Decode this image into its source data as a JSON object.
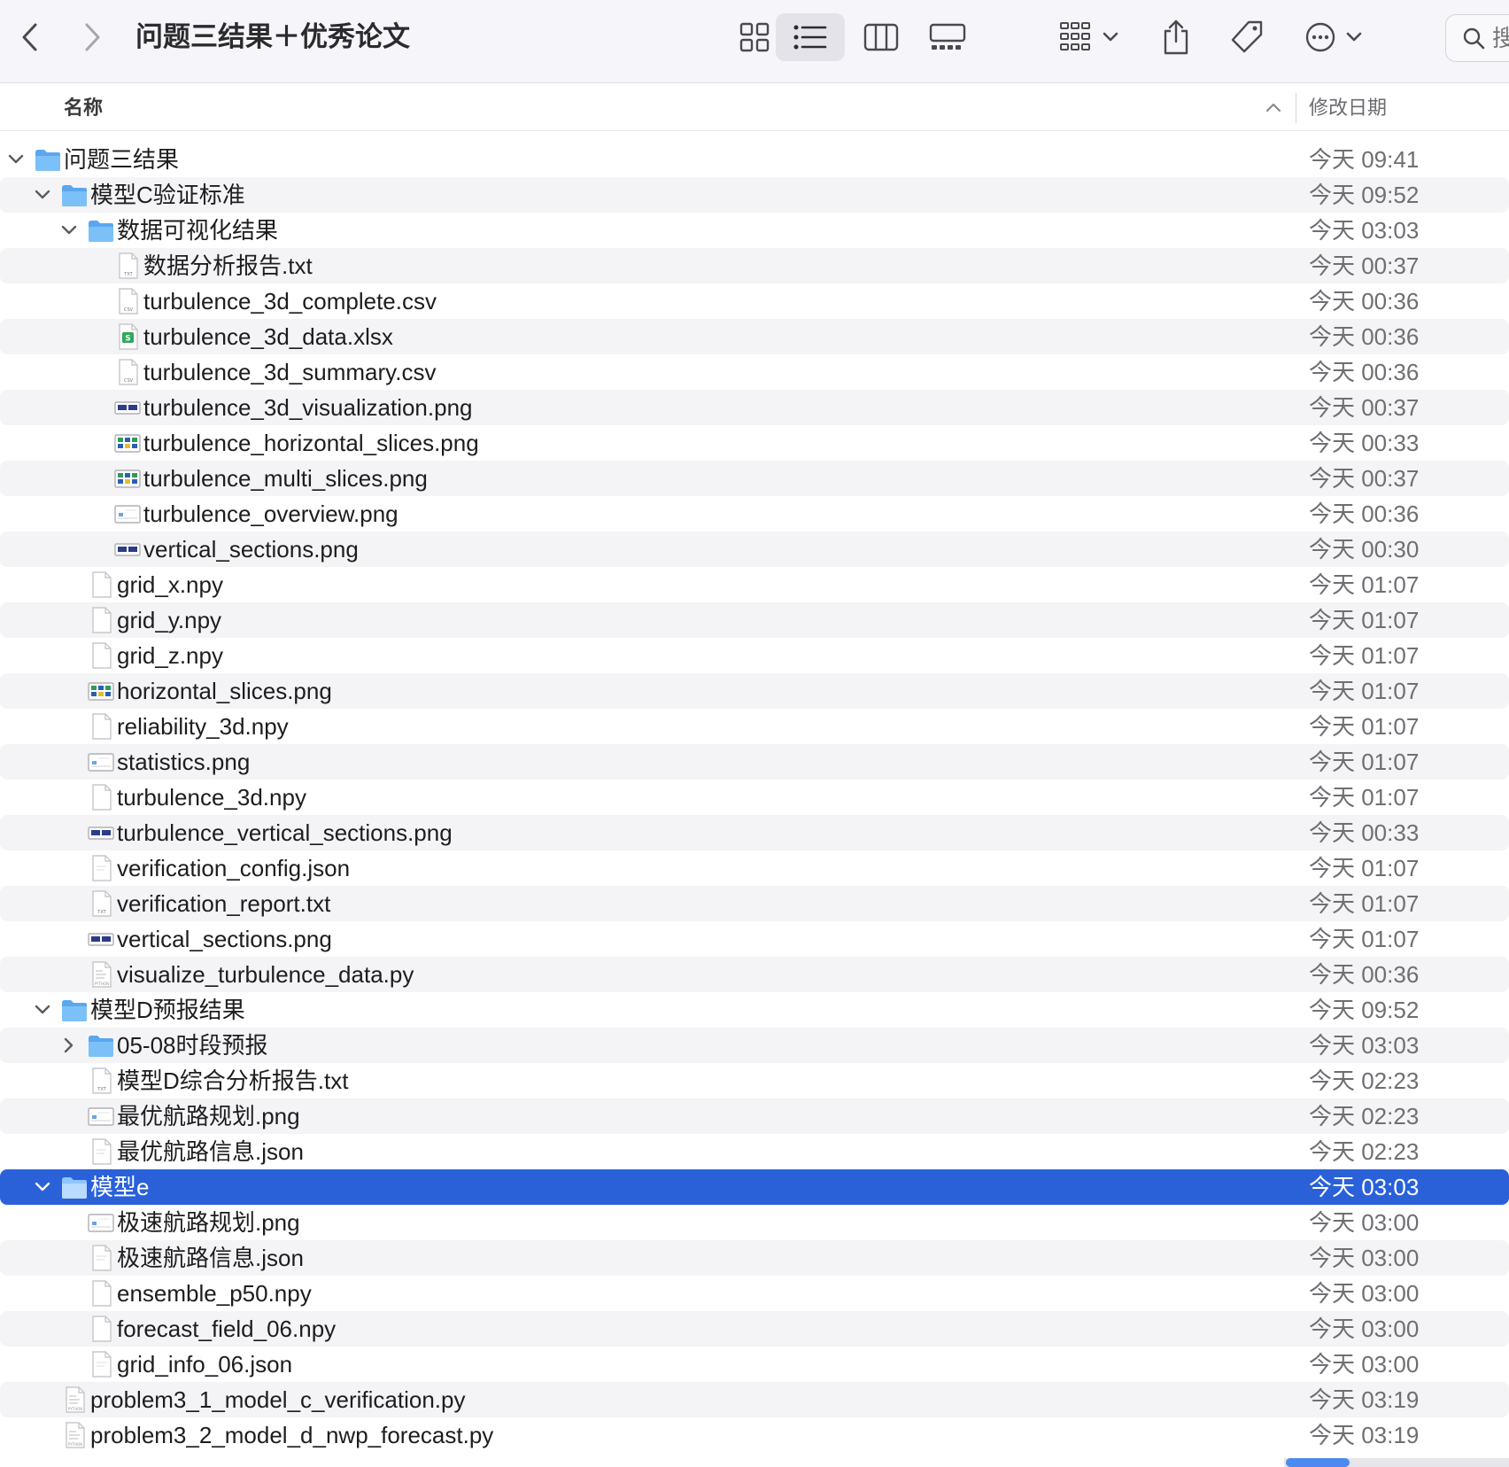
{
  "window": {
    "title": "问题三结果＋优秀论文"
  },
  "toolbar": {
    "back": "chevron-left-icon",
    "forward": "chevron-right-icon",
    "views": [
      "icon-view-icon",
      "list-view-icon",
      "column-view-icon",
      "gallery-view-icon"
    ],
    "active_view": "list",
    "group": "group-by-icon",
    "share": "share-icon",
    "tag": "tag-icon",
    "more": "more-icon",
    "search_placeholder": "搜索"
  },
  "columns": {
    "name": "名称",
    "date": "修改日期",
    "sort": "ascending"
  },
  "colors": {
    "selection": "#2a61d9",
    "folder": "#5aa7ee",
    "stripe": "#f4f4f6"
  },
  "rows": [
    {
      "name": "问题三结果",
      "date": "今天 09:41",
      "type": "folder",
      "depth": 0,
      "expanded": true
    },
    {
      "name": "模型C验证标准",
      "date": "今天 09:52",
      "type": "folder",
      "depth": 1,
      "expanded": true
    },
    {
      "name": "数据可视化结果",
      "date": "今天 03:03",
      "type": "folder",
      "depth": 2,
      "expanded": true
    },
    {
      "name": "数据分析报告.txt",
      "date": "今天 00:37",
      "type": "txt",
      "depth": 3
    },
    {
      "name": "turbulence_3d_complete.csv",
      "date": "今天 00:36",
      "type": "csv",
      "depth": 3
    },
    {
      "name": "turbulence_3d_data.xlsx",
      "date": "今天 00:36",
      "type": "xlsx",
      "depth": 3
    },
    {
      "name": "turbulence_3d_summary.csv",
      "date": "今天 00:36",
      "type": "csv",
      "depth": 3
    },
    {
      "name": "turbulence_3d_visualization.png",
      "date": "今天 00:37",
      "type": "png-wide",
      "depth": 3
    },
    {
      "name": "turbulence_horizontal_slices.png",
      "date": "今天 00:33",
      "type": "png-grid",
      "depth": 3
    },
    {
      "name": "turbulence_multi_slices.png",
      "date": "今天 00:37",
      "type": "png-grid",
      "depth": 3
    },
    {
      "name": "turbulence_overview.png",
      "date": "今天 00:36",
      "type": "png-light",
      "depth": 3
    },
    {
      "name": "vertical_sections.png",
      "date": "今天 00:30",
      "type": "png-wide",
      "depth": 3
    },
    {
      "name": "grid_x.npy",
      "date": "今天 01:07",
      "type": "blank",
      "depth": 2
    },
    {
      "name": "grid_y.npy",
      "date": "今天 01:07",
      "type": "blank",
      "depth": 2
    },
    {
      "name": "grid_z.npy",
      "date": "今天 01:07",
      "type": "blank",
      "depth": 2
    },
    {
      "name": "horizontal_slices.png",
      "date": "今天 01:07",
      "type": "png-grid",
      "depth": 2
    },
    {
      "name": "reliability_3d.npy",
      "date": "今天 01:07",
      "type": "blank",
      "depth": 2
    },
    {
      "name": "statistics.png",
      "date": "今天 01:07",
      "type": "png-light",
      "depth": 2
    },
    {
      "name": "turbulence_3d.npy",
      "date": "今天 01:07",
      "type": "blank",
      "depth": 2
    },
    {
      "name": "turbulence_vertical_sections.png",
      "date": "今天 00:33",
      "type": "png-wide",
      "depth": 2
    },
    {
      "name": "verification_config.json",
      "date": "今天 01:07",
      "type": "json",
      "depth": 2
    },
    {
      "name": "verification_report.txt",
      "date": "今天 01:07",
      "type": "txt",
      "depth": 2
    },
    {
      "name": "vertical_sections.png",
      "date": "今天 01:07",
      "type": "png-wide",
      "depth": 2
    },
    {
      "name": "visualize_turbulence_data.py",
      "date": "今天 00:36",
      "type": "py",
      "depth": 2
    },
    {
      "name": "模型D预报结果",
      "date": "今天 09:52",
      "type": "folder",
      "depth": 1,
      "expanded": true
    },
    {
      "name": "05-08时段预报",
      "date": "今天 03:03",
      "type": "folder",
      "depth": 2,
      "expanded": false
    },
    {
      "name": "模型D综合分析报告.txt",
      "date": "今天 02:23",
      "type": "txt",
      "depth": 2
    },
    {
      "name": "最优航路规划.png",
      "date": "今天 02:23",
      "type": "png-light",
      "depth": 2
    },
    {
      "name": "最优航路信息.json",
      "date": "今天 02:23",
      "type": "json",
      "depth": 2
    },
    {
      "name": "模型e",
      "date": "今天 03:03",
      "type": "folder",
      "depth": 1,
      "expanded": true,
      "selected": true
    },
    {
      "name": "极速航路规划.png",
      "date": "今天 03:00",
      "type": "png-light",
      "depth": 2
    },
    {
      "name": "极速航路信息.json",
      "date": "今天 03:00",
      "type": "json",
      "depth": 2
    },
    {
      "name": "ensemble_p50.npy",
      "date": "今天 03:00",
      "type": "blank",
      "depth": 2
    },
    {
      "name": "forecast_field_06.npy",
      "date": "今天 03:00",
      "type": "blank",
      "depth": 2
    },
    {
      "name": "grid_info_06.json",
      "date": "今天 03:00",
      "type": "json",
      "depth": 2
    },
    {
      "name": "problem3_1_model_c_verification.py",
      "date": "今天 03:19",
      "type": "py",
      "depth": 1
    },
    {
      "name": "problem3_2_model_d_nwp_forecast.py",
      "date": "今天 03:19",
      "type": "py",
      "depth": 1
    }
  ]
}
